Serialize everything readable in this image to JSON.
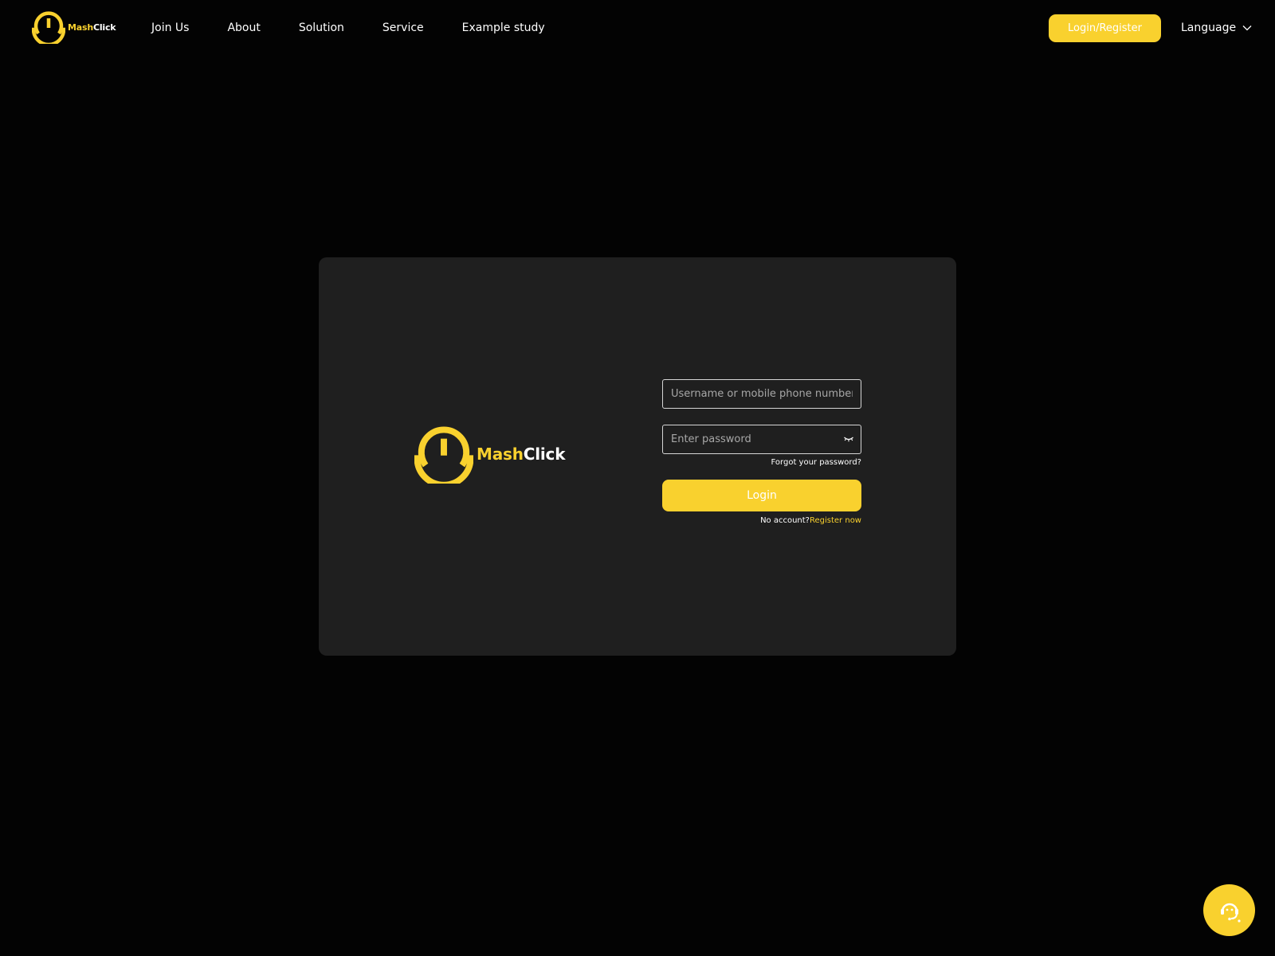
{
  "brand": {
    "name_part1": "Mash",
    "name_part2": "Click",
    "accent_color": "#f9d12e"
  },
  "nav": {
    "items": [
      {
        "label": "Join Us"
      },
      {
        "label": "About"
      },
      {
        "label": "Solution"
      },
      {
        "label": "Service"
      },
      {
        "label": "Example study"
      }
    ],
    "login_register_label": "Login/Register",
    "language_label": "Language"
  },
  "login_form": {
    "username_placeholder": "Username or mobile phone number",
    "password_placeholder": "Enter password",
    "forgot_label": "Forgot your password?",
    "login_label": "Login",
    "no_account_text": "No account?",
    "register_label": "Register now"
  },
  "icons": {
    "logo": "power-logo-icon",
    "language_chevron": "chevron-down-icon",
    "password_toggle": "eye-closed-icon",
    "support": "customer-service-icon"
  }
}
